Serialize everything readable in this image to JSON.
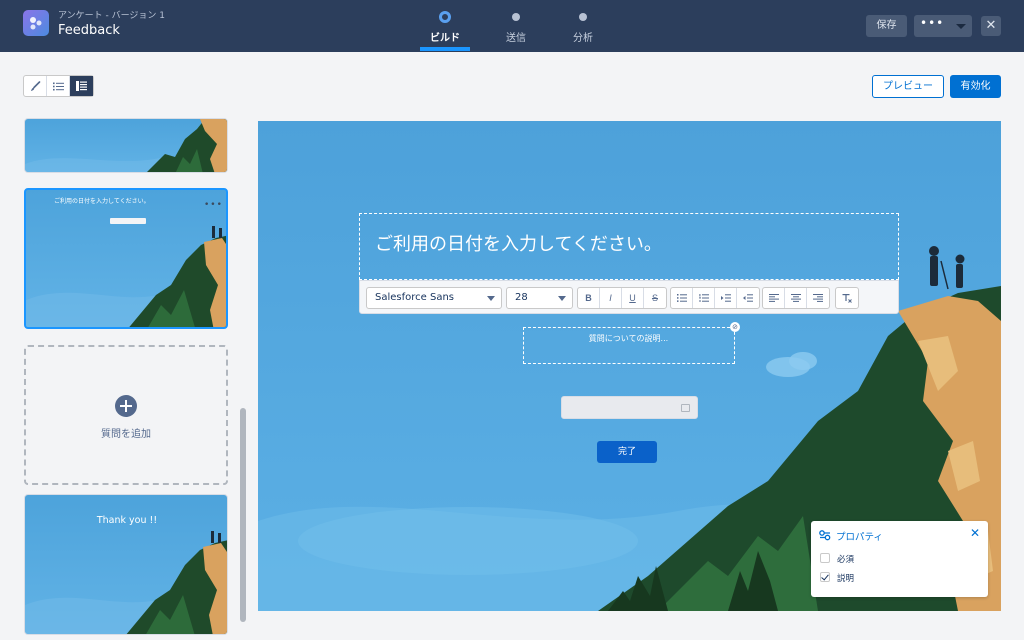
{
  "header": {
    "subtitle": "アンケート - バージョン 1",
    "title": "Feedback",
    "steps": [
      {
        "label": "ビルド",
        "active": true
      },
      {
        "label": "送信",
        "active": false
      },
      {
        "label": "分析",
        "active": false
      }
    ],
    "save_label": "保存",
    "more_label": "•••",
    "close_label": "✕",
    "accent_color": "#1b96ff",
    "bar_color": "#2c3e5c"
  },
  "toolbar": {
    "view_buttons": [
      {
        "icon": "brush-icon",
        "active": false
      },
      {
        "icon": "list-icon",
        "active": false
      },
      {
        "icon": "page-list-icon",
        "active": true
      }
    ],
    "preview_label": "プレビュー",
    "activate_label": "有効化"
  },
  "left_panel": {
    "thumb_question_text": "ご利用の日付を入力してください。",
    "thumb_menu": "•••",
    "add_question_label": "質問を追加",
    "thank_you_text": "Thank you !!"
  },
  "editor": {
    "question_title": "ご利用の日付を入力してください。",
    "font_family": "Salesforce Sans",
    "font_size": "28",
    "format_buttons": [
      "B",
      "I",
      "U",
      "S"
    ],
    "description_placeholder": "質問についての説明...",
    "done_label": "完了"
  },
  "properties": {
    "title": "プロパティ",
    "close_label": "✕",
    "options": [
      {
        "label": "必須",
        "checked": false
      },
      {
        "label": "説明",
        "checked": true
      }
    ]
  }
}
